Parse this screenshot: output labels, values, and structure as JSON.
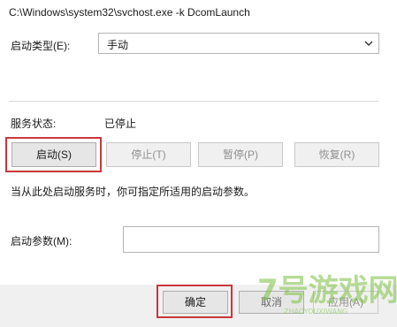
{
  "executable_path": "C:\\Windows\\system32\\svchost.exe -k DcomLaunch",
  "startup_type": {
    "label": "启动类型(E):",
    "value": "手动"
  },
  "service_status": {
    "label": "服务状态:",
    "value": "已停止"
  },
  "buttons": {
    "start": "启动(S)",
    "stop": "停止(T)",
    "pause": "暂停(P)",
    "resume": "恢复(R)"
  },
  "hint": "当从此处启动服务时，你可指定所适用的启动参数。",
  "start_params": {
    "label": "启动参数(M):",
    "value": ""
  },
  "footer": {
    "ok": "确定",
    "cancel": "取消",
    "apply": "应用(A)"
  },
  "watermark": {
    "brand": "7号游戏网",
    "sub": "ZHAOYOUXIWANG"
  },
  "colors": {
    "highlight": "#c9373b",
    "watermark_green": "#7cc142"
  }
}
